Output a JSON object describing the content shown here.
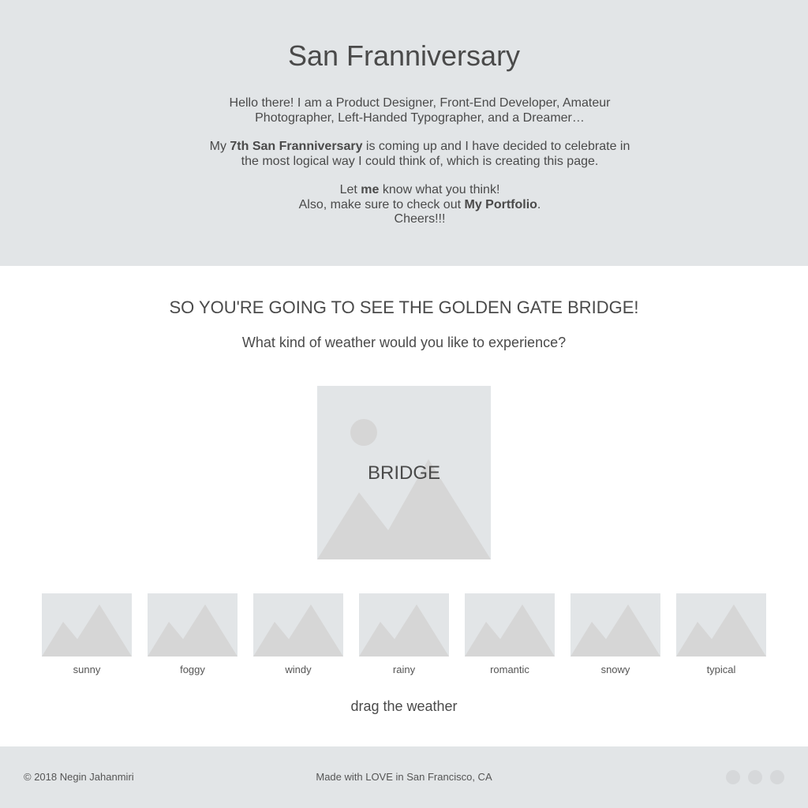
{
  "intro": {
    "title": "San Franniversary",
    "para1": "Hello there! I am a Product Designer, Front-End Developer, Amateur Photographer, Left-Handed Typographer, and a Dreamer…",
    "para2": {
      "before": "My ",
      "bold": "7th San Franniversary",
      "after": " is coming up and I have decided to celebrate in the most logical way I could think of, which is creating this page."
    },
    "para3": {
      "let": "Let ",
      "me_link": "me",
      "know": " know what you think!",
      "also": "Also, make sure to check out ",
      "portfolio_link": "My Portfolio",
      "period": ".",
      "cheers": "Cheers!!!"
    }
  },
  "main": {
    "heading": "SO YOU'RE GOING TO SEE THE GOLDEN GATE BRIDGE!",
    "subheading": "What kind of weather would you like to experience?",
    "bridge_label": "BRIDGE",
    "weather_options": [
      "sunny",
      "foggy",
      "windy",
      "rainy",
      "romantic",
      "snowy",
      "typical"
    ],
    "drag_hint": "drag the weather"
  },
  "footer": {
    "copyright": "© 2018 Negin Jahanmiri",
    "made_with": "Made with LOVE in San Francisco, CA",
    "social_icons": [
      "social-icon-1",
      "social-icon-2",
      "social-icon-3"
    ]
  },
  "colors": {
    "panel_bg": "#e2e5e7",
    "placeholder_shape": "#d6d6d6",
    "text": "#4a4a4a"
  }
}
